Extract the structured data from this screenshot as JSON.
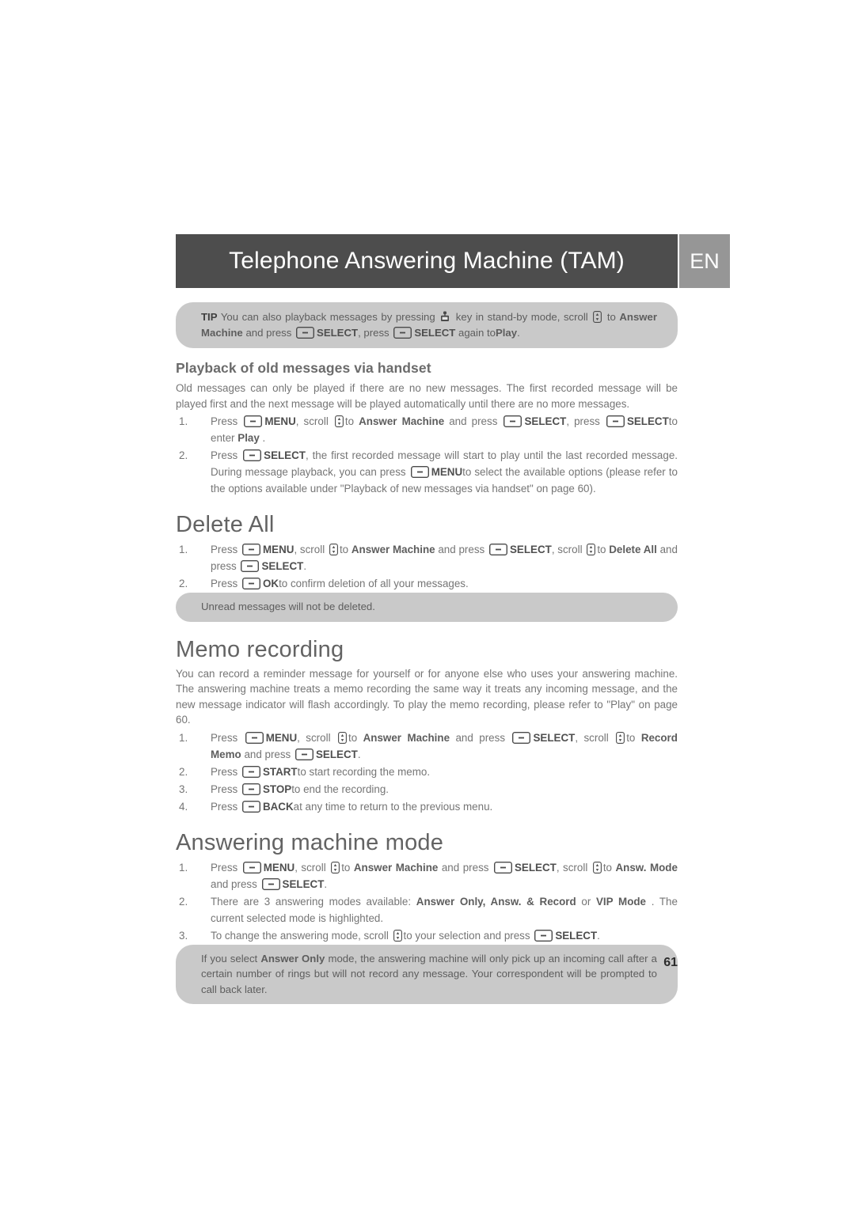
{
  "header": {
    "title": "Telephone Answering Machine (TAM)",
    "language_badge": "EN",
    "title_bar_color": "#4d4d4d",
    "language_badge_color": "#969696"
  },
  "callout_color": "#c9c9c9",
  "tip": {
    "lead": "TIP",
    "part1": "You can also playback messages by pressing",
    "icon1": "playback-key-icon",
    "part2": "key in stand-by mode, scroll",
    "icon2": "scroll-updown-icon",
    "part3": "to",
    "menu1": "Answer Machine",
    "part4": "and press",
    "icon3": "softkey-icon",
    "key1": "SELECT",
    "part5": ", press",
    "icon4": "softkey-icon",
    "key2": "SELECT",
    "part6": "again to",
    "menu2": "Play",
    "part7": "."
  },
  "playback_section": {
    "heading": "Playback of old messages via handset",
    "intro": "Old messages can only be played if there are no new messages. The first recorded message will be played first and the next message will be played automatically until there are no more messages.",
    "steps": [
      {
        "number": "1.",
        "segments": [
          {
            "t": "text",
            "v": "Press"
          },
          {
            "t": "icon",
            "v": "softkey-icon"
          },
          {
            "t": "key",
            "v": "MENU"
          },
          {
            "t": "text",
            "v": ", scroll"
          },
          {
            "t": "icon",
            "v": "scroll-updown-icon"
          },
          {
            "t": "text",
            "v": "to"
          },
          {
            "t": "menu",
            "v": "Answer Machine"
          },
          {
            "t": "text",
            "v": "and press"
          },
          {
            "t": "icon",
            "v": "softkey-icon"
          },
          {
            "t": "key",
            "v": "SELECT"
          },
          {
            "t": "text",
            "v": ", press"
          },
          {
            "t": "icon",
            "v": "softkey-icon"
          },
          {
            "t": "key",
            "v": "SELECT"
          },
          {
            "t": "text",
            "v": "to enter"
          },
          {
            "t": "menu",
            "v": "Play"
          },
          {
            "t": "text",
            "v": "."
          }
        ]
      },
      {
        "number": "2.",
        "segments": [
          {
            "t": "text",
            "v": "Press"
          },
          {
            "t": "icon",
            "v": "softkey-icon"
          },
          {
            "t": "key",
            "v": "SELECT"
          },
          {
            "t": "text",
            "v": ", the first recorded message will start to play until the last recorded message. During message playback, you can press"
          },
          {
            "t": "icon",
            "v": "softkey-icon"
          },
          {
            "t": "key",
            "v": "MENU"
          },
          {
            "t": "text",
            "v": "to select the available options (please refer to the options available under \"Playback of new messages via handset\" on page 60)."
          }
        ]
      }
    ]
  },
  "delete_all_section": {
    "heading": "Delete All",
    "steps": [
      {
        "number": "1.",
        "segments": [
          {
            "t": "text",
            "v": "Press"
          },
          {
            "t": "icon",
            "v": "softkey-icon"
          },
          {
            "t": "key",
            "v": "MENU"
          },
          {
            "t": "text",
            "v": ", scroll"
          },
          {
            "t": "icon",
            "v": "scroll-updown-icon"
          },
          {
            "t": "text",
            "v": "to"
          },
          {
            "t": "menu",
            "v": "Answer Machine"
          },
          {
            "t": "text",
            "v": "and press"
          },
          {
            "t": "icon",
            "v": "softkey-icon"
          },
          {
            "t": "key",
            "v": "SELECT"
          },
          {
            "t": "text",
            "v": ", scroll"
          },
          {
            "t": "icon",
            "v": "scroll-updown-icon"
          },
          {
            "t": "text",
            "v": "to"
          },
          {
            "t": "menu",
            "v": "Delete All"
          },
          {
            "t": "text",
            "v": "and press"
          },
          {
            "t": "icon",
            "v": "softkey-icon"
          },
          {
            "t": "key",
            "v": "SELECT"
          },
          {
            "t": "text",
            "v": "."
          }
        ]
      },
      {
        "number": "2.",
        "segments": [
          {
            "t": "text",
            "v": "Press"
          },
          {
            "t": "icon",
            "v": "softkey-icon"
          },
          {
            "t": "key",
            "v": "OK"
          },
          {
            "t": "text",
            "v": "to confirm deletion of all your messages."
          }
        ]
      }
    ],
    "note": "Unread messages will not be deleted."
  },
  "memo_section": {
    "heading": "Memo recording",
    "intro": "You can record a reminder message for yourself or for anyone else who uses your answering machine. The answering machine treats a memo recording the same way it treats any incoming message, and the new message indicator will flash accordingly. To play the memo recording, please refer to \"Play\" on page 60.",
    "steps": [
      {
        "number": "1.",
        "segments": [
          {
            "t": "text",
            "v": "Press"
          },
          {
            "t": "icon",
            "v": "softkey-icon"
          },
          {
            "t": "key",
            "v": "MENU"
          },
          {
            "t": "text",
            "v": ", scroll"
          },
          {
            "t": "icon",
            "v": "scroll-updown-icon"
          },
          {
            "t": "text",
            "v": "to"
          },
          {
            "t": "menu",
            "v": "Answer Machine"
          },
          {
            "t": "text",
            "v": "and press"
          },
          {
            "t": "icon",
            "v": "softkey-icon"
          },
          {
            "t": "key",
            "v": "SELECT"
          },
          {
            "t": "text",
            "v": ", scroll"
          },
          {
            "t": "icon",
            "v": "scroll-updown-icon"
          },
          {
            "t": "text",
            "v": "to"
          },
          {
            "t": "menu",
            "v": "Record Memo"
          },
          {
            "t": "text",
            "v": "and press"
          },
          {
            "t": "icon",
            "v": "softkey-icon"
          },
          {
            "t": "key",
            "v": "SELECT"
          },
          {
            "t": "text",
            "v": "."
          }
        ]
      },
      {
        "number": "2.",
        "segments": [
          {
            "t": "text",
            "v": "Press"
          },
          {
            "t": "icon",
            "v": "softkey-icon"
          },
          {
            "t": "key",
            "v": "START"
          },
          {
            "t": "text",
            "v": "to start recording the memo."
          }
        ]
      },
      {
        "number": "3.",
        "segments": [
          {
            "t": "text",
            "v": "Press"
          },
          {
            "t": "icon",
            "v": "softkey-icon"
          },
          {
            "t": "key",
            "v": "STOP"
          },
          {
            "t": "text",
            "v": "to end the recording."
          }
        ]
      },
      {
        "number": "4.",
        "segments": [
          {
            "t": "text",
            "v": "Press"
          },
          {
            "t": "icon",
            "v": "softkey-icon"
          },
          {
            "t": "key",
            "v": "BACK"
          },
          {
            "t": "text",
            "v": "at any time to return to the previous menu."
          }
        ]
      }
    ]
  },
  "mode_section": {
    "heading": "Answering machine mode",
    "steps": [
      {
        "number": "1.",
        "segments": [
          {
            "t": "text",
            "v": "Press"
          },
          {
            "t": "icon",
            "v": "softkey-icon"
          },
          {
            "t": "key",
            "v": "MENU"
          },
          {
            "t": "text",
            "v": ", scroll"
          },
          {
            "t": "icon",
            "v": "scroll-updown-icon"
          },
          {
            "t": "text",
            "v": "to"
          },
          {
            "t": "menu",
            "v": "Answer Machine"
          },
          {
            "t": "text",
            "v": "and press"
          },
          {
            "t": "icon",
            "v": "softkey-icon"
          },
          {
            "t": "key",
            "v": "SELECT"
          },
          {
            "t": "text",
            "v": ", scroll"
          },
          {
            "t": "icon",
            "v": "scroll-updown-icon"
          },
          {
            "t": "text",
            "v": "to"
          },
          {
            "t": "menu",
            "v": "Answ. Mode"
          },
          {
            "t": "text",
            "v": "and press"
          },
          {
            "t": "icon",
            "v": "softkey-icon"
          },
          {
            "t": "key",
            "v": "SELECT"
          },
          {
            "t": "text",
            "v": "."
          }
        ]
      },
      {
        "number": "2.",
        "segments": [
          {
            "t": "text",
            "v": "There are 3 answering modes available:"
          },
          {
            "t": "menu",
            "v": "Answer Only, Answ. & Record"
          },
          {
            "t": "text",
            "v": "or"
          },
          {
            "t": "menu",
            "v": "VIP Mode"
          },
          {
            "t": "text",
            "v": ". The current selected mode is highlighted."
          }
        ]
      },
      {
        "number": "3.",
        "segments": [
          {
            "t": "text",
            "v": "To change the answering mode, scroll"
          },
          {
            "t": "icon",
            "v": "scroll-updown-icon"
          },
          {
            "t": "text",
            "v": "to your selection and press"
          },
          {
            "t": "icon",
            "v": "softkey-icon"
          },
          {
            "t": "key",
            "v": "SELECT"
          },
          {
            "t": "text",
            "v": "."
          }
        ]
      }
    ],
    "note": {
      "part1": "If you select",
      "mode_name": "Answer Only",
      "part2": "mode, the answering machine will only pick up an incoming call after a certain number of rings but will not record any message. Your correspondent will be prompted to call back later."
    }
  },
  "footer": {
    "page_number": "61"
  }
}
